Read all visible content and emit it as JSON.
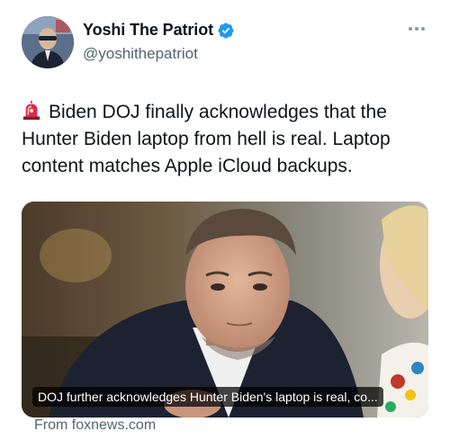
{
  "author": {
    "display_name": "Yoshi The Patriot",
    "handle": "@yoshithepatriot",
    "verified_color": "#1d9bf0",
    "avatar_icon": "profile-photo"
  },
  "tweet": {
    "emoji": "police-car-light-icon",
    "lines": [
      "Biden DOJ finally acknowledges that the",
      "Hunter Biden laptop from hell is real. Laptop",
      "content matches Apple iCloud backups."
    ]
  },
  "card": {
    "caption": "DOJ further acknowledges Hunter Biden's laptop is real, co...",
    "source": "From foxnews.com"
  },
  "colors": {
    "text_primary": "#0f1419",
    "text_secondary": "#536471"
  }
}
